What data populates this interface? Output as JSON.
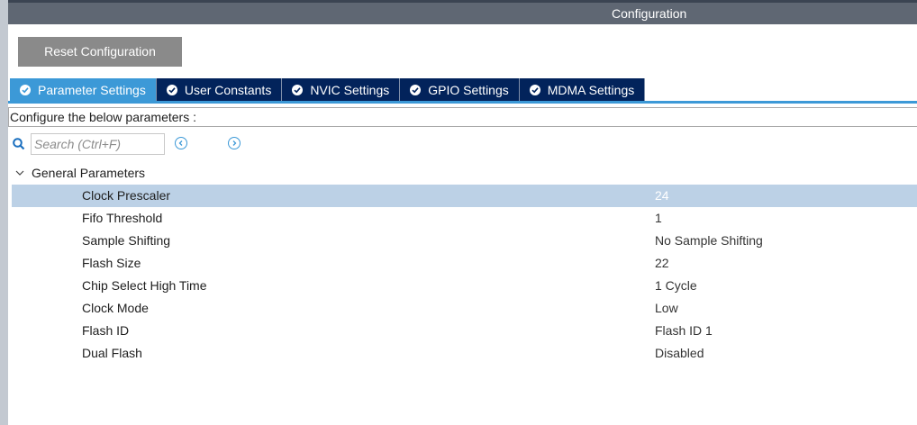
{
  "window": {
    "title": "Configuration"
  },
  "toolbar": {
    "reset_label": "Reset Configuration"
  },
  "tabs": [
    {
      "label": "Parameter Settings",
      "active": true
    },
    {
      "label": "User Constants",
      "active": false
    },
    {
      "label": "NVIC Settings",
      "active": false
    },
    {
      "label": "GPIO Settings",
      "active": false
    },
    {
      "label": "MDMA Settings",
      "active": false
    }
  ],
  "description": "Configure the below parameters :",
  "search": {
    "placeholder": "Search (Ctrl+F)",
    "value": ""
  },
  "group": {
    "label": "General Parameters",
    "expanded": true
  },
  "params": [
    {
      "name": "Clock Prescaler",
      "value": "24",
      "selected": true
    },
    {
      "name": "Fifo Threshold",
      "value": "1",
      "selected": false
    },
    {
      "name": "Sample Shifting",
      "value": "No Sample Shifting",
      "selected": false
    },
    {
      "name": "Flash Size",
      "value": "22",
      "selected": false
    },
    {
      "name": "Chip Select High Time",
      "value": "1 Cycle",
      "selected": false
    },
    {
      "name": "Clock Mode",
      "value": "Low",
      "selected": false
    },
    {
      "name": "Flash ID",
      "value": "Flash ID 1",
      "selected": false
    },
    {
      "name": "Dual Flash",
      "value": "Disabled",
      "selected": false
    }
  ],
  "colors": {
    "accent": "#3c99d7",
    "tab_inactive": "#02235b",
    "titlebar": "#5f6773",
    "selection": "#bcd1e6"
  },
  "icons": {
    "tab_status": "check-circle-icon",
    "search": "search-icon",
    "prev": "chevron-left-circle-icon",
    "next": "chevron-right-circle-icon",
    "group_toggle": "chevron-down-icon"
  }
}
